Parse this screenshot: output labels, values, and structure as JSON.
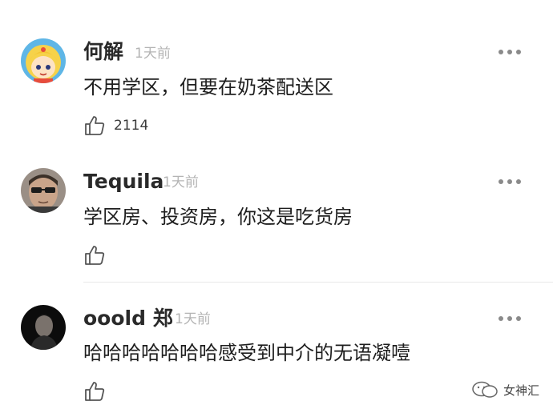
{
  "comments": [
    {
      "user": "何解",
      "time": "1天前",
      "text": "不用学区，但要在奶茶配送区",
      "likes": "2114",
      "avatar_icon": "cartoon-sailor-moon-avatar"
    },
    {
      "user": "Tequila",
      "time": "1天前",
      "text": "学区房、投资房，你这是吃货房",
      "likes": "",
      "avatar_icon": "man-with-sunglasses-avatar"
    },
    {
      "user": "ooold 郑",
      "time": "1天前",
      "text": "哈哈哈哈哈哈哈感受到中介的无语凝噎",
      "likes": "",
      "avatar_icon": "dark-portrait-avatar"
    }
  ],
  "icons": {
    "like": "thumbs-up-icon",
    "more": "more-options-icon"
  },
  "watermark": {
    "label": "女神汇"
  },
  "colors": {
    "time": "#b4b4b4",
    "divider": "#e8e8e8",
    "username": "#2a2a2a"
  }
}
